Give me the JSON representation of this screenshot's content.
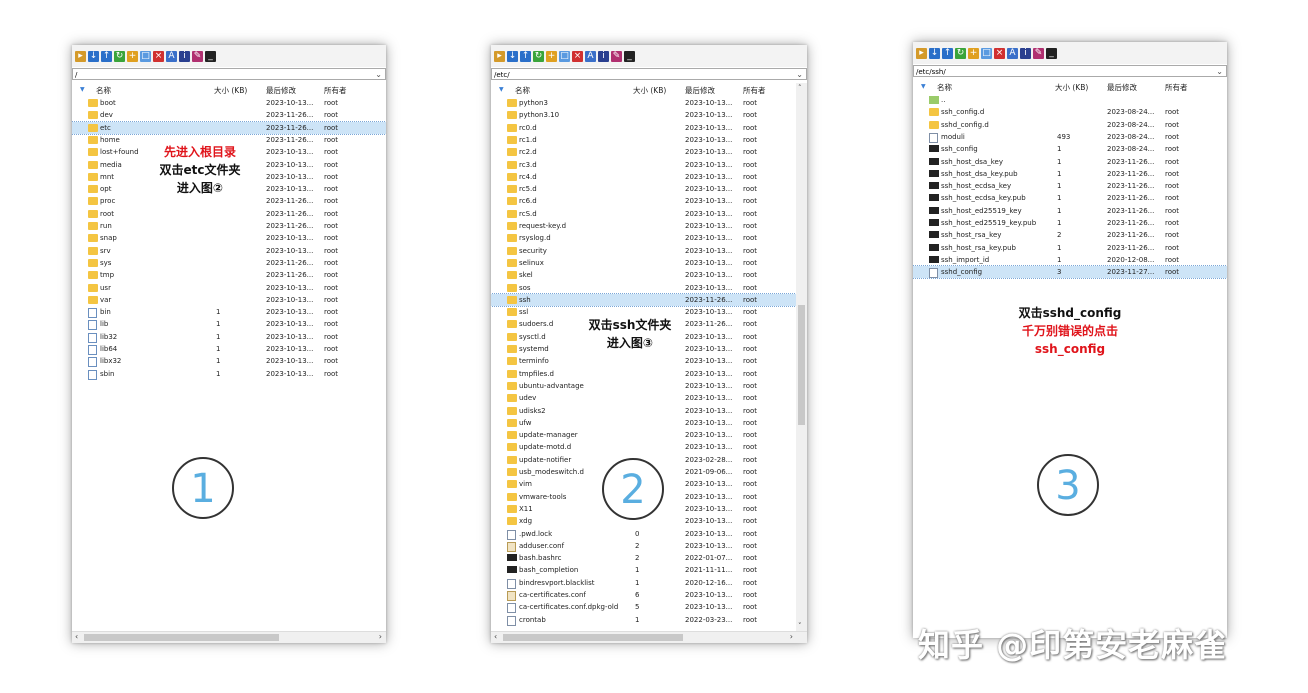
{
  "columns": {
    "name": "名称",
    "size": "大小 (KB)",
    "modified": "最后修改",
    "owner": "所有者"
  },
  "panel1": {
    "path": "/",
    "annotation": {
      "line1": "先进入根目录",
      "line2": "双击etc文件夹",
      "line3": "进入图②"
    },
    "step_marker": "1",
    "rows": [
      {
        "icon": "folder",
        "name": "boot",
        "size": "",
        "date": "2023-10-13...",
        "owner": "root"
      },
      {
        "icon": "folder",
        "name": "dev",
        "size": "",
        "date": "2023-11-26...",
        "owner": "root"
      },
      {
        "icon": "folder",
        "name": "etc",
        "size": "",
        "date": "2023-11-26...",
        "owner": "root",
        "selected": true
      },
      {
        "icon": "folder",
        "name": "home",
        "size": "",
        "date": "2023-11-26...",
        "owner": "root"
      },
      {
        "icon": "folder",
        "name": "lost+found",
        "size": "",
        "date": "2023-10-13...",
        "owner": "root"
      },
      {
        "icon": "folder",
        "name": "media",
        "size": "",
        "date": "2023-10-13...",
        "owner": "root"
      },
      {
        "icon": "folder",
        "name": "mnt",
        "size": "",
        "date": "2023-10-13...",
        "owner": "root"
      },
      {
        "icon": "folder",
        "name": "opt",
        "size": "",
        "date": "2023-10-13...",
        "owner": "root"
      },
      {
        "icon": "folder",
        "name": "proc",
        "size": "",
        "date": "2023-11-26...",
        "owner": "root"
      },
      {
        "icon": "folder",
        "name": "root",
        "size": "",
        "date": "2023-11-26...",
        "owner": "root"
      },
      {
        "icon": "folder",
        "name": "run",
        "size": "",
        "date": "2023-11-26...",
        "owner": "root"
      },
      {
        "icon": "folder",
        "name": "snap",
        "size": "",
        "date": "2023-10-13...",
        "owner": "root"
      },
      {
        "icon": "folder",
        "name": "srv",
        "size": "",
        "date": "2023-10-13...",
        "owner": "root"
      },
      {
        "icon": "folder",
        "name": "sys",
        "size": "",
        "date": "2023-11-26...",
        "owner": "root"
      },
      {
        "icon": "folder",
        "name": "tmp",
        "size": "",
        "date": "2023-11-26...",
        "owner": "root"
      },
      {
        "icon": "folder",
        "name": "usr",
        "size": "",
        "date": "2023-10-13...",
        "owner": "root"
      },
      {
        "icon": "folder",
        "name": "var",
        "size": "",
        "date": "2023-10-13...",
        "owner": "root"
      },
      {
        "icon": "link",
        "name": "bin",
        "size": "1",
        "date": "2023-10-13...",
        "owner": "root"
      },
      {
        "icon": "link",
        "name": "lib",
        "size": "1",
        "date": "2023-10-13...",
        "owner": "root"
      },
      {
        "icon": "link",
        "name": "lib32",
        "size": "1",
        "date": "2023-10-13...",
        "owner": "root"
      },
      {
        "icon": "link",
        "name": "lib64",
        "size": "1",
        "date": "2023-10-13...",
        "owner": "root"
      },
      {
        "icon": "link",
        "name": "libx32",
        "size": "1",
        "date": "2023-10-13...",
        "owner": "root"
      },
      {
        "icon": "link",
        "name": "sbin",
        "size": "1",
        "date": "2023-10-13...",
        "owner": "root"
      }
    ]
  },
  "panel2": {
    "path": "/etc/",
    "annotation": {
      "line1": "双击ssh文件夹",
      "line2": "进入图③"
    },
    "step_marker": "2",
    "rows": [
      {
        "icon": "folder",
        "name": "python3",
        "size": "",
        "date": "2023-10-13...",
        "owner": "root"
      },
      {
        "icon": "folder",
        "name": "python3.10",
        "size": "",
        "date": "2023-10-13...",
        "owner": "root"
      },
      {
        "icon": "folder",
        "name": "rc0.d",
        "size": "",
        "date": "2023-10-13...",
        "owner": "root"
      },
      {
        "icon": "folder",
        "name": "rc1.d",
        "size": "",
        "date": "2023-10-13...",
        "owner": "root"
      },
      {
        "icon": "folder",
        "name": "rc2.d",
        "size": "",
        "date": "2023-10-13...",
        "owner": "root"
      },
      {
        "icon": "folder",
        "name": "rc3.d",
        "size": "",
        "date": "2023-10-13...",
        "owner": "root"
      },
      {
        "icon": "folder",
        "name": "rc4.d",
        "size": "",
        "date": "2023-10-13...",
        "owner": "root"
      },
      {
        "icon": "folder",
        "name": "rc5.d",
        "size": "",
        "date": "2023-10-13...",
        "owner": "root"
      },
      {
        "icon": "folder",
        "name": "rc6.d",
        "size": "",
        "date": "2023-10-13...",
        "owner": "root"
      },
      {
        "icon": "folder",
        "name": "rcS.d",
        "size": "",
        "date": "2023-10-13...",
        "owner": "root"
      },
      {
        "icon": "folder",
        "name": "request-key.d",
        "size": "",
        "date": "2023-10-13...",
        "owner": "root"
      },
      {
        "icon": "folder",
        "name": "rsyslog.d",
        "size": "",
        "date": "2023-10-13...",
        "owner": "root"
      },
      {
        "icon": "folder",
        "name": "security",
        "size": "",
        "date": "2023-10-13...",
        "owner": "root"
      },
      {
        "icon": "folder",
        "name": "selinux",
        "size": "",
        "date": "2023-10-13...",
        "owner": "root"
      },
      {
        "icon": "folder",
        "name": "skel",
        "size": "",
        "date": "2023-10-13...",
        "owner": "root"
      },
      {
        "icon": "folder",
        "name": "sos",
        "size": "",
        "date": "2023-10-13...",
        "owner": "root"
      },
      {
        "icon": "folder",
        "name": "ssh",
        "size": "",
        "date": "2023-11-26...",
        "owner": "root",
        "selected": true
      },
      {
        "icon": "folder",
        "name": "ssl",
        "size": "",
        "date": "2023-10-13...",
        "owner": "root"
      },
      {
        "icon": "folder",
        "name": "sudoers.d",
        "size": "",
        "date": "2023-11-26...",
        "owner": "root"
      },
      {
        "icon": "folder",
        "name": "sysctl.d",
        "size": "",
        "date": "2023-10-13...",
        "owner": "root"
      },
      {
        "icon": "folder",
        "name": "systemd",
        "size": "",
        "date": "2023-10-13...",
        "owner": "root"
      },
      {
        "icon": "folder",
        "name": "terminfo",
        "size": "",
        "date": "2023-10-13...",
        "owner": "root"
      },
      {
        "icon": "folder",
        "name": "tmpfiles.d",
        "size": "",
        "date": "2023-10-13...",
        "owner": "root"
      },
      {
        "icon": "folder",
        "name": "ubuntu-advantage",
        "size": "",
        "date": "2023-10-13...",
        "owner": "root"
      },
      {
        "icon": "folder",
        "name": "udev",
        "size": "",
        "date": "2023-10-13...",
        "owner": "root"
      },
      {
        "icon": "folder",
        "name": "udisks2",
        "size": "",
        "date": "2023-10-13...",
        "owner": "root"
      },
      {
        "icon": "folder",
        "name": "ufw",
        "size": "",
        "date": "2023-10-13...",
        "owner": "root"
      },
      {
        "icon": "folder",
        "name": "update-manager",
        "size": "",
        "date": "2023-10-13...",
        "owner": "root"
      },
      {
        "icon": "folder",
        "name": "update-motd.d",
        "size": "",
        "date": "2023-10-13...",
        "owner": "root"
      },
      {
        "icon": "folder",
        "name": "update-notifier",
        "size": "",
        "date": "2023-02-28...",
        "owner": "root"
      },
      {
        "icon": "folder",
        "name": "usb_modeswitch.d",
        "size": "",
        "date": "2021-09-06...",
        "owner": "root"
      },
      {
        "icon": "folder",
        "name": "vim",
        "size": "",
        "date": "2023-10-13...",
        "owner": "root"
      },
      {
        "icon": "folder",
        "name": "vmware-tools",
        "size": "",
        "date": "2023-10-13...",
        "owner": "root"
      },
      {
        "icon": "folder",
        "name": "X11",
        "size": "",
        "date": "2023-10-13...",
        "owner": "root"
      },
      {
        "icon": "folder",
        "name": "xdg",
        "size": "",
        "date": "2023-10-13...",
        "owner": "root"
      },
      {
        "icon": "file",
        "name": ".pwd.lock",
        "size": "0",
        "date": "2023-10-13...",
        "owner": "root"
      },
      {
        "icon": "conf",
        "name": "adduser.conf",
        "size": "2",
        "date": "2023-10-13...",
        "owner": "root"
      },
      {
        "icon": "term",
        "name": "bash.bashrc",
        "size": "2",
        "date": "2022-01-07...",
        "owner": "root"
      },
      {
        "icon": "term",
        "name": "bash_completion",
        "size": "1",
        "date": "2021-11-11...",
        "owner": "root"
      },
      {
        "icon": "file",
        "name": "bindresvport.blacklist",
        "size": "1",
        "date": "2020-12-16...",
        "owner": "root"
      },
      {
        "icon": "conf",
        "name": "ca-certificates.conf",
        "size": "6",
        "date": "2023-10-13...",
        "owner": "root"
      },
      {
        "icon": "file",
        "name": "ca-certificates.conf.dpkg-old",
        "size": "5",
        "date": "2023-10-13...",
        "owner": "root"
      },
      {
        "icon": "file",
        "name": "crontab",
        "size": "1",
        "date": "2022-03-23...",
        "owner": "root"
      }
    ]
  },
  "panel3": {
    "path": "/etc/ssh/",
    "annotation": {
      "line1": "双击sshd_config",
      "line2": "千万别错误的点击",
      "line3": "ssh_config"
    },
    "step_marker": "3",
    "rows": [
      {
        "icon": "up",
        "name": "..",
        "size": "",
        "date": "",
        "owner": ""
      },
      {
        "icon": "folder",
        "name": "ssh_config.d",
        "size": "",
        "date": "2023-08-24...",
        "owner": "root"
      },
      {
        "icon": "folder",
        "name": "sshd_config.d",
        "size": "",
        "date": "2023-08-24...",
        "owner": "root"
      },
      {
        "icon": "file",
        "name": "moduli",
        "size": "493",
        "date": "2023-08-24...",
        "owner": "root"
      },
      {
        "icon": "term",
        "name": "ssh_config",
        "size": "1",
        "date": "2023-08-24...",
        "owner": "root"
      },
      {
        "icon": "term",
        "name": "ssh_host_dsa_key",
        "size": "1",
        "date": "2023-11-26...",
        "owner": "root"
      },
      {
        "icon": "term",
        "name": "ssh_host_dsa_key.pub",
        "size": "1",
        "date": "2023-11-26...",
        "owner": "root"
      },
      {
        "icon": "term",
        "name": "ssh_host_ecdsa_key",
        "size": "1",
        "date": "2023-11-26...",
        "owner": "root"
      },
      {
        "icon": "term",
        "name": "ssh_host_ecdsa_key.pub",
        "size": "1",
        "date": "2023-11-26...",
        "owner": "root"
      },
      {
        "icon": "term",
        "name": "ssh_host_ed25519_key",
        "size": "1",
        "date": "2023-11-26...",
        "owner": "root"
      },
      {
        "icon": "term",
        "name": "ssh_host_ed25519_key.pub",
        "size": "1",
        "date": "2023-11-26...",
        "owner": "root"
      },
      {
        "icon": "term",
        "name": "ssh_host_rsa_key",
        "size": "2",
        "date": "2023-11-26...",
        "owner": "root"
      },
      {
        "icon": "term",
        "name": "ssh_host_rsa_key.pub",
        "size": "1",
        "date": "2023-11-26...",
        "owner": "root"
      },
      {
        "icon": "term",
        "name": "ssh_import_id",
        "size": "1",
        "date": "2020-12-08...",
        "owner": "root"
      },
      {
        "icon": "file",
        "name": "sshd_config",
        "size": "3",
        "date": "2023-11-27...",
        "owner": "root",
        "selected": true
      }
    ]
  },
  "watermark": "知乎 @印第安老麻雀",
  "colors": {
    "accent": "#3a7fd5",
    "selection": "#cde4f7",
    "folder": "#f4c542",
    "annotation_red": "#e0141b"
  }
}
